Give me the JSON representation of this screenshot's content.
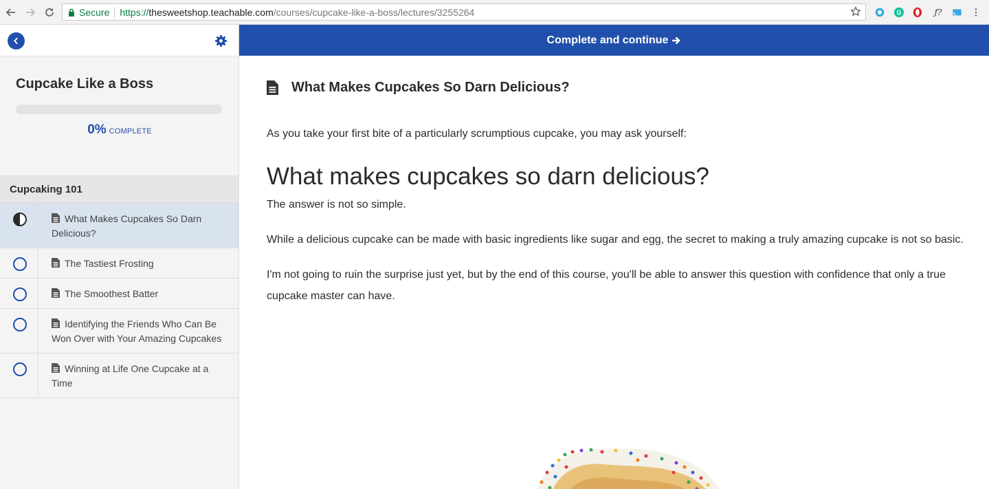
{
  "browser": {
    "secure_label": "Secure",
    "url_scheme": "https://",
    "url_host": "thesweetshop.teachable.com",
    "url_path": "/courses/cupcake-like-a-boss/lectures/3255264",
    "extensions": [
      "circle-ext-icon",
      "grammarly-icon",
      "opera-icon",
      "fx-icon",
      "cast-icon",
      "menu-icon"
    ]
  },
  "sidebar": {
    "course_title": "Cupcake Like a Boss",
    "progress_percent": "0%",
    "progress_fraction": 0,
    "progress_suffix": "COMPLETE",
    "section_title": "Cupcaking 101",
    "lectures": [
      {
        "title": "What Makes Cupcakes So Darn Delicious?",
        "status": "in-progress"
      },
      {
        "title": "The Tastiest Frosting",
        "status": "not-started"
      },
      {
        "title": "The Smoothest Batter",
        "status": "not-started"
      },
      {
        "title": "Identifying the Friends Who Can Be Won Over with Your Amazing Cupcakes",
        "status": "not-started"
      },
      {
        "title": "Winning at Life One Cupcake at a Time",
        "status": "not-started"
      }
    ]
  },
  "topbar": {
    "complete_label": "Complete and continue"
  },
  "lecture": {
    "heading": "What Makes Cupcakes So Darn Delicious?",
    "intro": "As you take your first bite of a particularly scrumptious cupcake, you may ask yourself:",
    "h1": "What makes cupcakes so darn delicious?",
    "p1": "The answer is not so simple.",
    "p2": "While a delicious cupcake can be made with basic ingredients like sugar and egg, the secret to making a truly amazing cupcake is not so basic.",
    "p3": "I'm not going to ruin the surprise just yet, but by the end of this course, you'll be able to answer this question with confidence that only a true cupcake master can have."
  },
  "colors": {
    "brand_blue": "#2050ab",
    "active_row": "#d9e3ef",
    "secure_green": "#0b8043"
  }
}
